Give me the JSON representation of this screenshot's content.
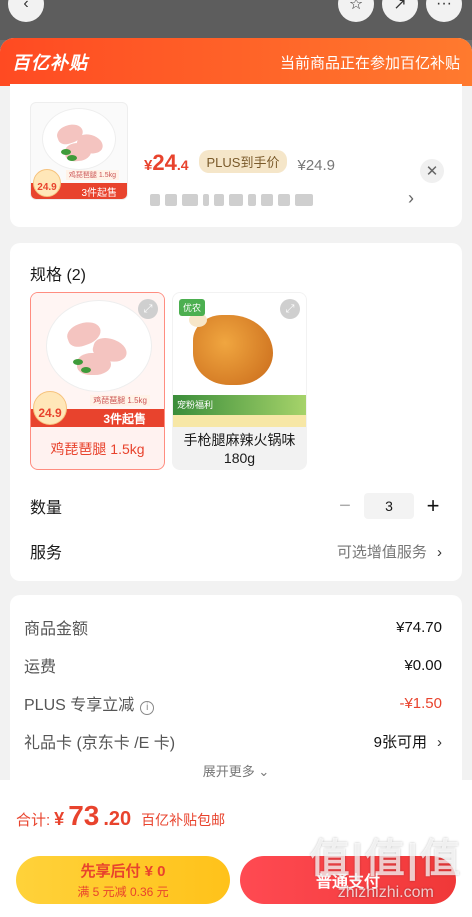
{
  "banner": {
    "logo": "百亿补贴",
    "notice": "当前商品正在参加百亿补贴"
  },
  "product": {
    "price_yen": "¥",
    "price_int": "24",
    "price_dec": ".4",
    "plus_tag": "PLUS到手价",
    "orig_price": "¥24.9",
    "thumb_price": "24.9",
    "thumb_strip": "3件起售",
    "thumb_weight": "鸡琵琶腿 1.5kg"
  },
  "spec": {
    "title": "规格 (2)",
    "options": [
      {
        "label": "鸡琵琶腿 1.5kg",
        "strip": "3件起售",
        "badge": "24.9",
        "weight": "鸡琵琶腿 1.5kg",
        "selected": true
      },
      {
        "label": "手枪腿麻辣火锅味 180g",
        "tag": "优农",
        "band_text": "宠粉福利",
        "selected": false
      }
    ]
  },
  "quantity": {
    "label": "数量",
    "minus": "−",
    "value": "3",
    "plus": "+"
  },
  "service": {
    "label": "服务",
    "value": "可选增值服务"
  },
  "costs": {
    "goods_label": "商品金额",
    "goods_value": "¥74.70",
    "shipping_label": "运费",
    "shipping_value": "¥0.00",
    "plus_label": "PLUS 专享立减",
    "plus_value": "-¥1.50",
    "giftcard_label": "礼品卡 (京东卡 /E 卡)",
    "giftcard_value": "9张可用",
    "more": "展开更多"
  },
  "footer": {
    "total_label": "合计:",
    "total_yen": "¥",
    "total_int": "73",
    "total_dec": ".20",
    "total_note": "百亿补贴包邮",
    "later_title": "先享后付 ¥ 0",
    "later_sub": "满 5 元减 0.36 元",
    "pay_label": "普通支付"
  },
  "watermark": {
    "logo": "值|值|值",
    "url": "zhizhizhi.com"
  },
  "icons": {
    "close": "close-icon",
    "chevron": "chevron-right-icon",
    "expand": "expand-icon",
    "info": "info-icon"
  },
  "colors": {
    "accent": "#e8432d",
    "banner": "#ff5a26",
    "pay": "#f03838",
    "later": "#ffc21a"
  }
}
